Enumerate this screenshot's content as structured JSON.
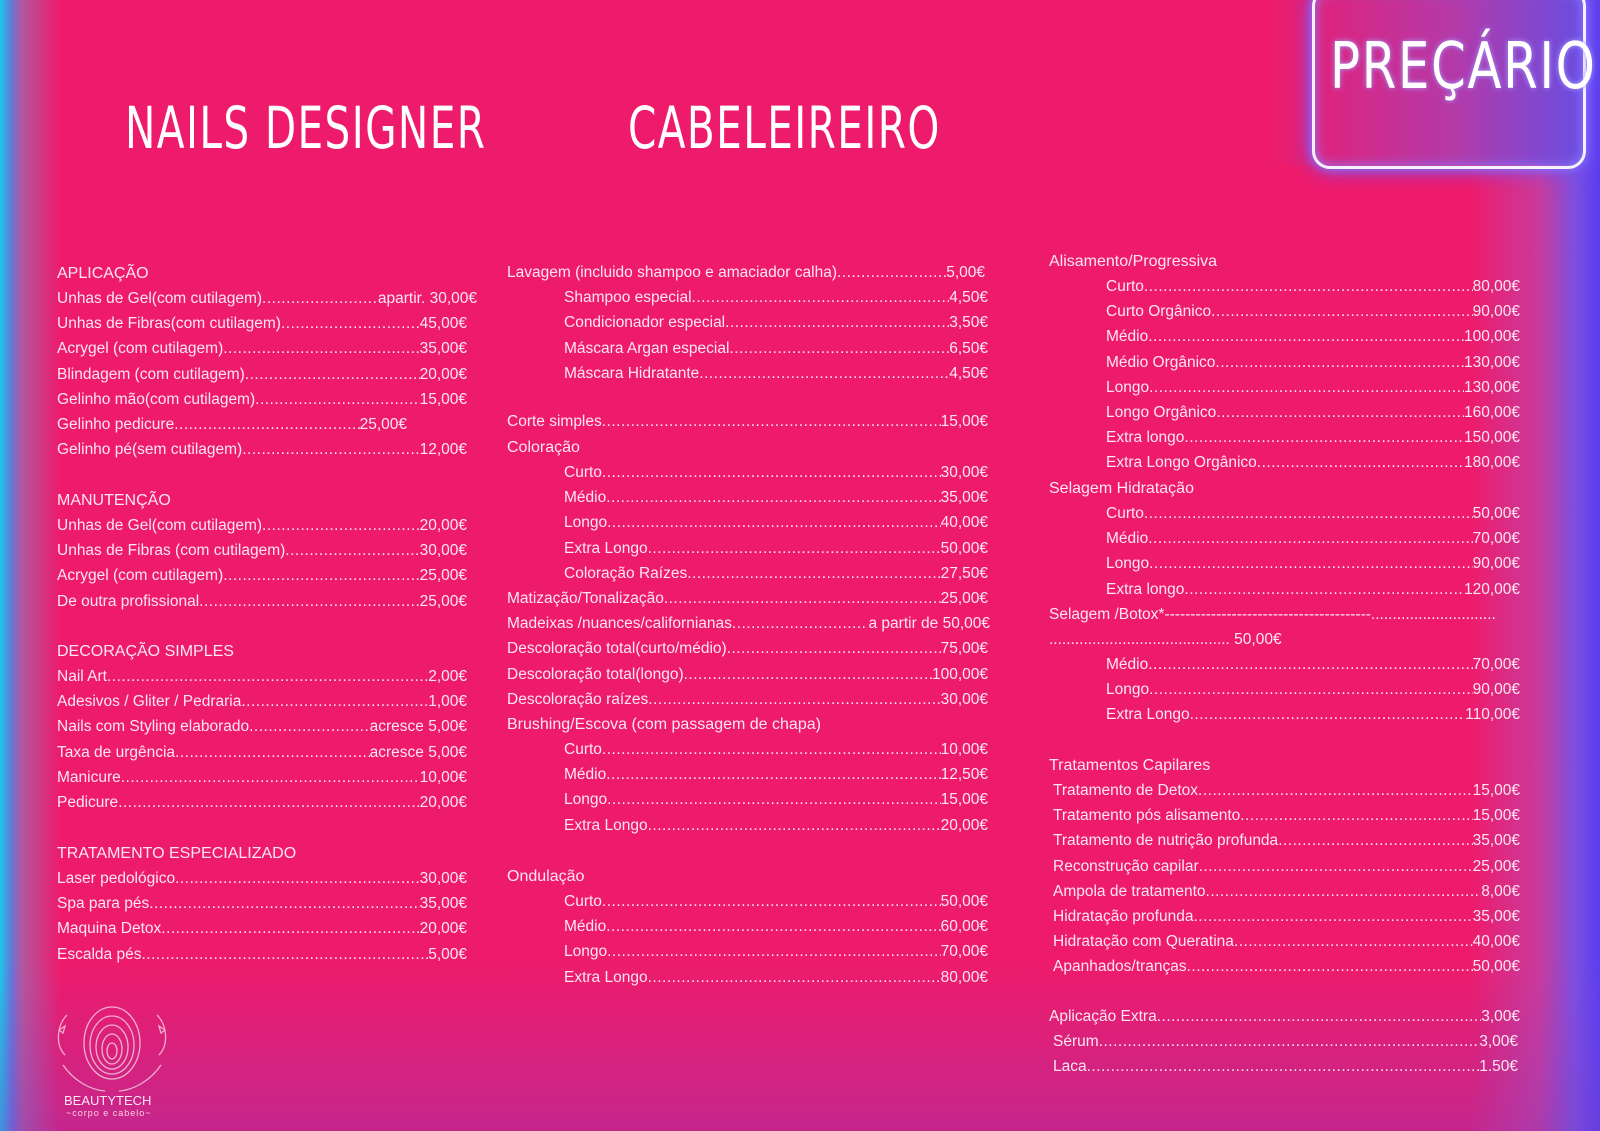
{
  "title": "PREÇÁRIO",
  "nails": {
    "heading": "NAILS DESIGNER",
    "groups": [
      {
        "title": "APLICAÇÃO",
        "items": [
          {
            "label": "Unhas de Gel(com cutilagem)",
            "price": "apartir. 30,00€"
          },
          {
            "label": "Unhas de Fibras(com cutilagem)",
            "price": "45,00€"
          },
          {
            "label": "Acrygel (com cutilagem)",
            "price": "35,00€"
          },
          {
            "label": "Blindagem (com cutilagem)",
            "price": "20,00€"
          },
          {
            "label": "Gelinho mão(com cutilagem)",
            "price": "15,00€"
          },
          {
            "label": "Gelinho pedicure",
            "price": "25,00€"
          },
          {
            "label": "Gelinho pé(sem cutilagem)",
            "price": "12,00€"
          }
        ]
      },
      {
        "title": "MANUTENÇÃO",
        "items": [
          {
            "label": "Unhas de Gel(com cutilagem)",
            "price": "20,00€"
          },
          {
            "label": "Unhas de Fibras (com cutilagem)",
            "price": "30,00€"
          },
          {
            "label": "Acrygel (com cutilagem)",
            "price": "25,00€"
          },
          {
            "label": "De outra profissional",
            "price": "25,00€"
          }
        ]
      },
      {
        "title": "DECORAÇÃO SIMPLES",
        "items": [
          {
            "label": "Nail Art",
            "price": "2,00€"
          },
          {
            "label": "Adesivos / Gliter / Pedraria",
            "price": "1,00€"
          },
          {
            "label": "Nails com Styling elaborado",
            "price": "acresce 5,00€"
          },
          {
            "label": "Taxa de urgência",
            "price": "acresce 5,00€"
          },
          {
            "label": "Manicure",
            "price": "10,00€"
          },
          {
            "label": "Pedicure",
            "price": "20,00€"
          }
        ]
      },
      {
        "title": "TRATAMENTO ESPECIALIZADO",
        "items": [
          {
            "label": "Laser pedológico",
            "price": "30,00€"
          },
          {
            "label": "Spa para pés",
            "price": "35,00€"
          },
          {
            "label": "Maquina Detox",
            "price": "20,00€"
          },
          {
            "label": "Escalda pés",
            "price": "5,00€"
          }
        ]
      }
    ]
  },
  "hair": {
    "heading": "CABELEIREIRO",
    "lavagem": {
      "label": "Lavagem  (incluido shampoo e amaciador calha)",
      "price": "5,00€"
    },
    "lavagem_sub": [
      {
        "label": "Shampoo especial",
        "price": "4,50€"
      },
      {
        "label": "Condicionador especial",
        "price": "3,50€"
      },
      {
        "label": "Máscara Argan especial",
        "price": "6,50€"
      },
      {
        "label": "Máscara Hidratante",
        "price": "4,50€"
      }
    ],
    "corte": {
      "label": "Corte simples",
      "price": "15,00€"
    },
    "coloracao_title": "Coloração",
    "coloracao": [
      {
        "label": "Curto",
        "price": "30,00€"
      },
      {
        "label": "Médio",
        "price": "35,00€"
      },
      {
        "label": "Longo",
        "price": "40,00€"
      },
      {
        "label": "Extra Longo",
        "price": "50,00€"
      },
      {
        "label": "Coloração Raízes",
        "price": "27,50€"
      }
    ],
    "other": [
      {
        "label": "Matização/Tonalização",
        "price": "25,00€"
      },
      {
        "label": "Madeixas /nuances/californianas",
        "price": "a partir de 50,00€"
      },
      {
        "label": "Descoloração total(curto/médio)",
        "price": "75,00€"
      },
      {
        "label": "Descoloração total(longo)",
        "price": "100,00€"
      },
      {
        "label": "Descoloração raízes",
        "price": "30,00€"
      }
    ],
    "brushing_title": "Brushing/Escova (com passagem de chapa)",
    "brushing": [
      {
        "label": "Curto",
        "price": "10,00€"
      },
      {
        "label": "Médio",
        "price": "12,50€"
      },
      {
        "label": "Longo",
        "price": "15,00€"
      },
      {
        "label": "Extra Longo",
        "price": "20,00€"
      }
    ],
    "ondulacao_title": "Ondulação",
    "ondulacao": [
      {
        "label": "Curto",
        "price": "50,00€"
      },
      {
        "label": "Médio",
        "price": "60,00€"
      },
      {
        "label": "Longo",
        "price": "70,00€"
      },
      {
        "label": "Extra Longo",
        "price": "80,00€"
      }
    ]
  },
  "right": {
    "alisamento_title": "Alisamento/Progressiva",
    "alisamento": [
      {
        "label": "Curto",
        "price": "80,00€"
      },
      {
        "label": "Curto Orgânico",
        "price": "90,00€"
      },
      {
        "label": "Médio",
        "price": "100,00€"
      },
      {
        "label": "Médio Orgânico",
        "price": "130,00€"
      },
      {
        "label": "Longo",
        "price": "130,00€"
      },
      {
        "label": "Longo Orgânico",
        "price": "160,00€"
      },
      {
        "label": "Extra longo",
        "price": "150,00€"
      },
      {
        "label": "Extra Longo Orgânico",
        "price": "180,00€"
      }
    ],
    "selagem_title": "Selagem Hidratação",
    "selagem": [
      {
        "label": "Curto",
        "price": "50,00€"
      },
      {
        "label": "Médio",
        "price": "70,00€"
      },
      {
        "label": "Longo",
        "price": "90,00€"
      },
      {
        "label": "Extra longo",
        "price": "120,00€"
      }
    ],
    "botox_line1": "Selagem /Botox*----------------------------------------.............................",
    "botox_line2": ".......................................... 50,00€",
    "botox": [
      {
        "label": "Médio",
        "price": "70,00€"
      },
      {
        "label": "Longo",
        "price": "90,00€"
      },
      {
        "label": "Extra Longo",
        "price": "110,00€"
      }
    ],
    "trat_title": "Tratamentos Capilares",
    "trat": [
      {
        "label": "Tratamento de Detox",
        "price": "15,00€"
      },
      {
        "label": "Tratamento pós alisamento",
        "price": "15,00€"
      },
      {
        "label": "Tratamento de nutrição profunda",
        "price": "35,00€"
      },
      {
        "label": "Reconstrução capilar",
        "price": "25,00€"
      },
      {
        "label": "Ampola de tratamento",
        "price": "8,00€"
      },
      {
        "label": "Hidratação profunda",
        "price": "35,00€"
      },
      {
        "label": "Hidratação com Queratina",
        "price": "40,00€"
      },
      {
        "label": "Apanhados/tranças",
        "price": "50,00€"
      }
    ],
    "extra": [
      {
        "label": "Aplicação Extra",
        "price": "3,00€"
      },
      {
        "label": "Sérum",
        "price": "3,00€"
      },
      {
        "label": "Laca",
        "price": "1.50€"
      }
    ]
  },
  "logo": {
    "name": "BEAUTYTECH",
    "tagline": "~corpo e cabelo~"
  }
}
